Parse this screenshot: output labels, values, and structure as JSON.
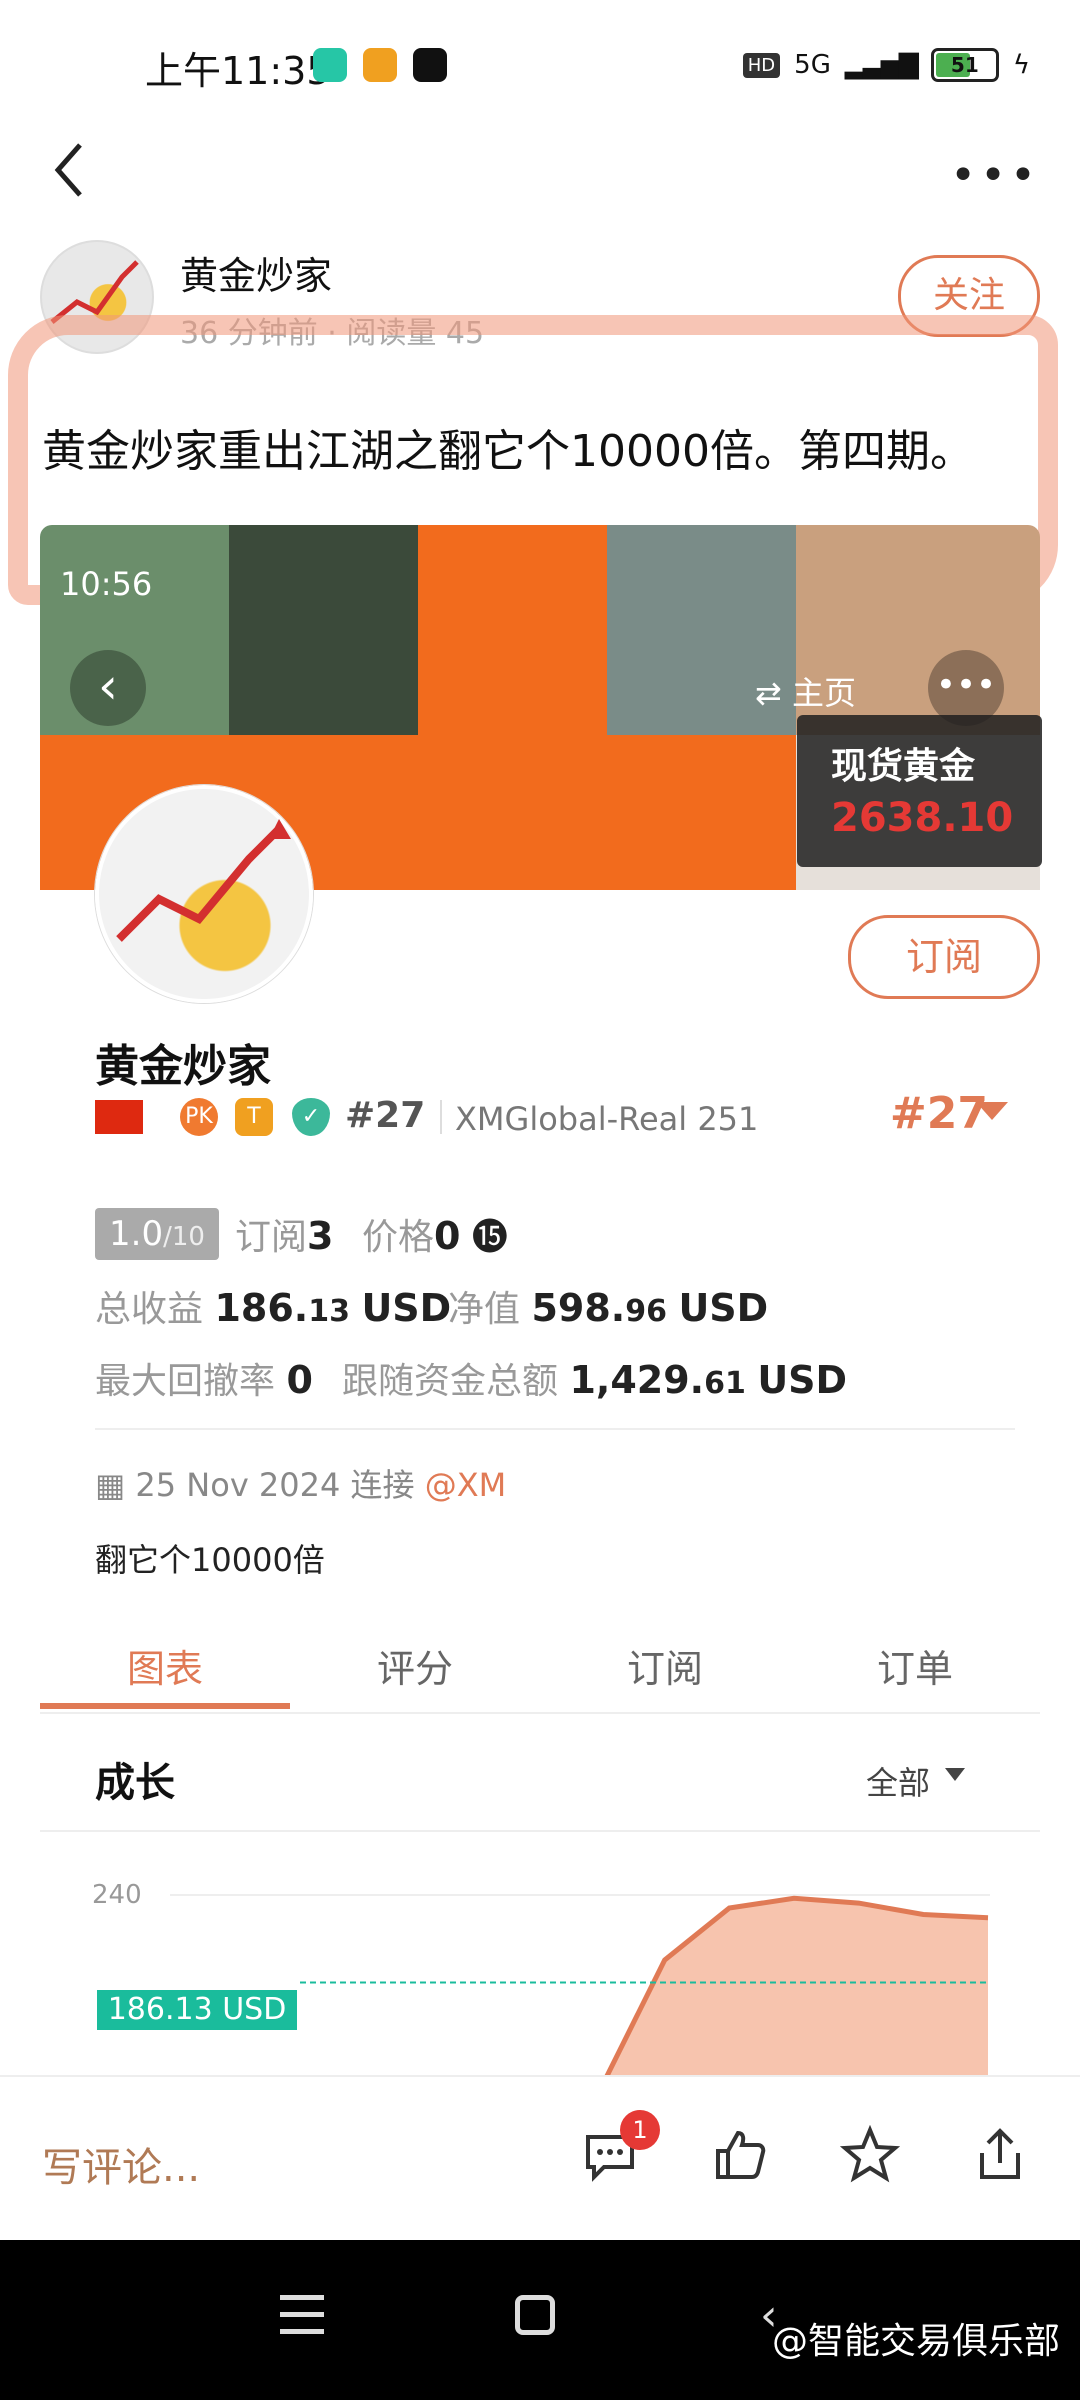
{
  "status_bar": {
    "time": "上午11:35",
    "network": "5G",
    "battery": "51"
  },
  "author": {
    "name": "黄金炒家",
    "time_ago": "36 分钟前",
    "reads": "阅读量 45",
    "follow_label": "关注"
  },
  "post_title": "黄金炒家重出江湖之翻它个10000倍。第四期。",
  "banner": {
    "time": "10:56",
    "home_label": "主页",
    "price_label": "现货黄金",
    "price_value": "2638.10"
  },
  "profile": {
    "subscribe_label": "订阅",
    "name": "黄金炒家",
    "rank_small": "#27",
    "account": "XMGlobal-Real 251",
    "rank_big": "#27",
    "badges": [
      "PK",
      "T"
    ],
    "score": "1.0",
    "score_max": "/10",
    "subs_label": "订阅",
    "subs_value": "3",
    "price_label": "价格",
    "price_value": "0",
    "total_profit_label": "总收益",
    "total_profit_int": "186.",
    "total_profit_dec": "13",
    "total_profit_unit": "USD",
    "nav_label": "净值",
    "nav_int": "598.",
    "nav_dec": "96",
    "nav_unit": "USD",
    "drawdown_label": "最大回撤率",
    "drawdown_value": "0",
    "follow_funds_label": "跟随资金总额",
    "follow_funds_int": "1,429.",
    "follow_funds_dec": "61",
    "follow_funds_unit": "USD",
    "date": "25 Nov 2024 连接",
    "broker": "@XM",
    "description": "翻它个10000倍"
  },
  "tabs": [
    "图表",
    "评分",
    "订阅",
    "订单"
  ],
  "chart_section": {
    "title": "成长",
    "filter": "全部",
    "y_tick": "240",
    "current_label": "186.13 USD"
  },
  "chart_data": {
    "type": "area",
    "title": "成长",
    "xlabel": "",
    "ylabel": "",
    "x": [
      0,
      1,
      2,
      3,
      4,
      5,
      6
    ],
    "values": [
      120,
      200,
      232,
      238,
      235,
      228,
      226
    ],
    "reference_value": 186.13,
    "yticks": [
      240
    ]
  },
  "bottom_bar": {
    "comment_placeholder": "写评论...",
    "comment_count": "1"
  },
  "watermark": "@智能交易俱乐部",
  "colors": {
    "accent": "#e07a55",
    "banner_orange": "#f26b1d",
    "teal": "#1abc9c",
    "red": "#e53935"
  }
}
